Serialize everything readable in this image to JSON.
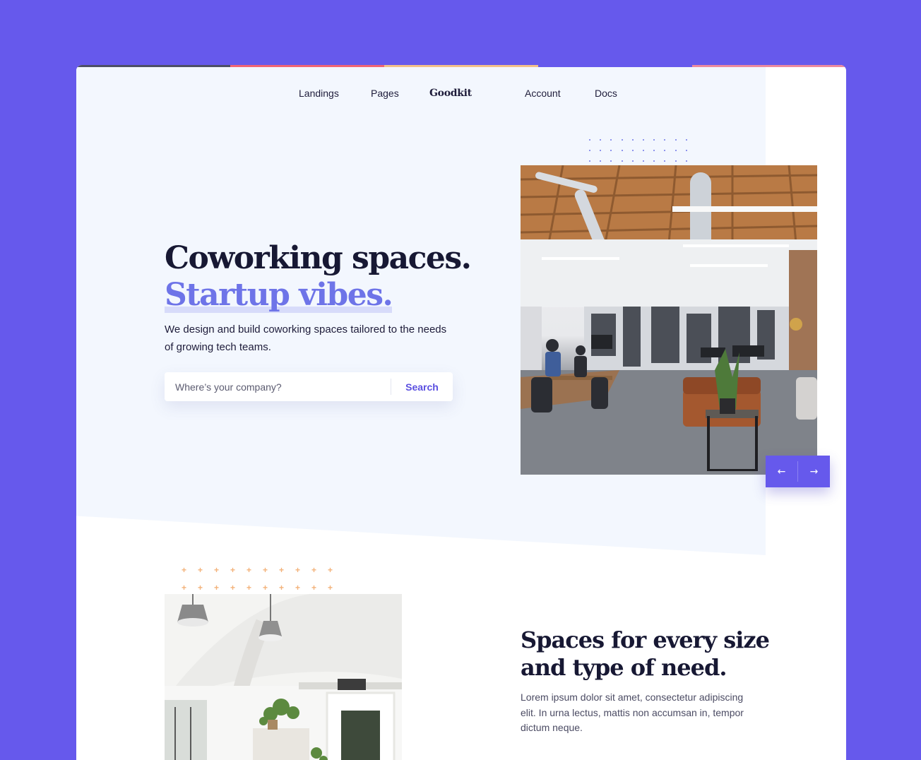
{
  "nav": {
    "items": [
      "Landings",
      "Pages",
      "Account",
      "Docs"
    ],
    "logo": "Goodkit"
  },
  "hero": {
    "title_line1": "Coworking spaces.",
    "title_line2": "Startup vibes.",
    "description": "We design and build coworking spaces tailored to the needs of growing tech teams.",
    "search_placeholder": "Where’s your company?",
    "search_button": "Search",
    "carousel_prev": "←",
    "carousel_next": "→"
  },
  "section2": {
    "title_line1": "Spaces for every size",
    "title_line2": "and type of need.",
    "body": "Lorem ipsum dolor sit amet, consectetur adipiscing elit. In urna lectus, mattis non accumsan in, tempor dictum neque."
  },
  "decor": {
    "plus_glyph": "+"
  },
  "colors": {
    "background": "#6659EC",
    "hero_bg": "#F3F7FE",
    "accent": "#6E74E8",
    "heading": "#171833",
    "search_button": "#5A4FE0",
    "carousel": "#6659EC",
    "plus": "#F3B27A",
    "top_bar": [
      "#4C4F66",
      "#F06474",
      "#F2C089",
      "#6659EC",
      "#EC8A9E"
    ]
  },
  "icons": {
    "carousel_prev": "arrow-left-icon",
    "carousel_next": "arrow-right-icon",
    "dot_pattern": "dot-grid-icon",
    "plus_pattern": "plus-grid-icon"
  }
}
